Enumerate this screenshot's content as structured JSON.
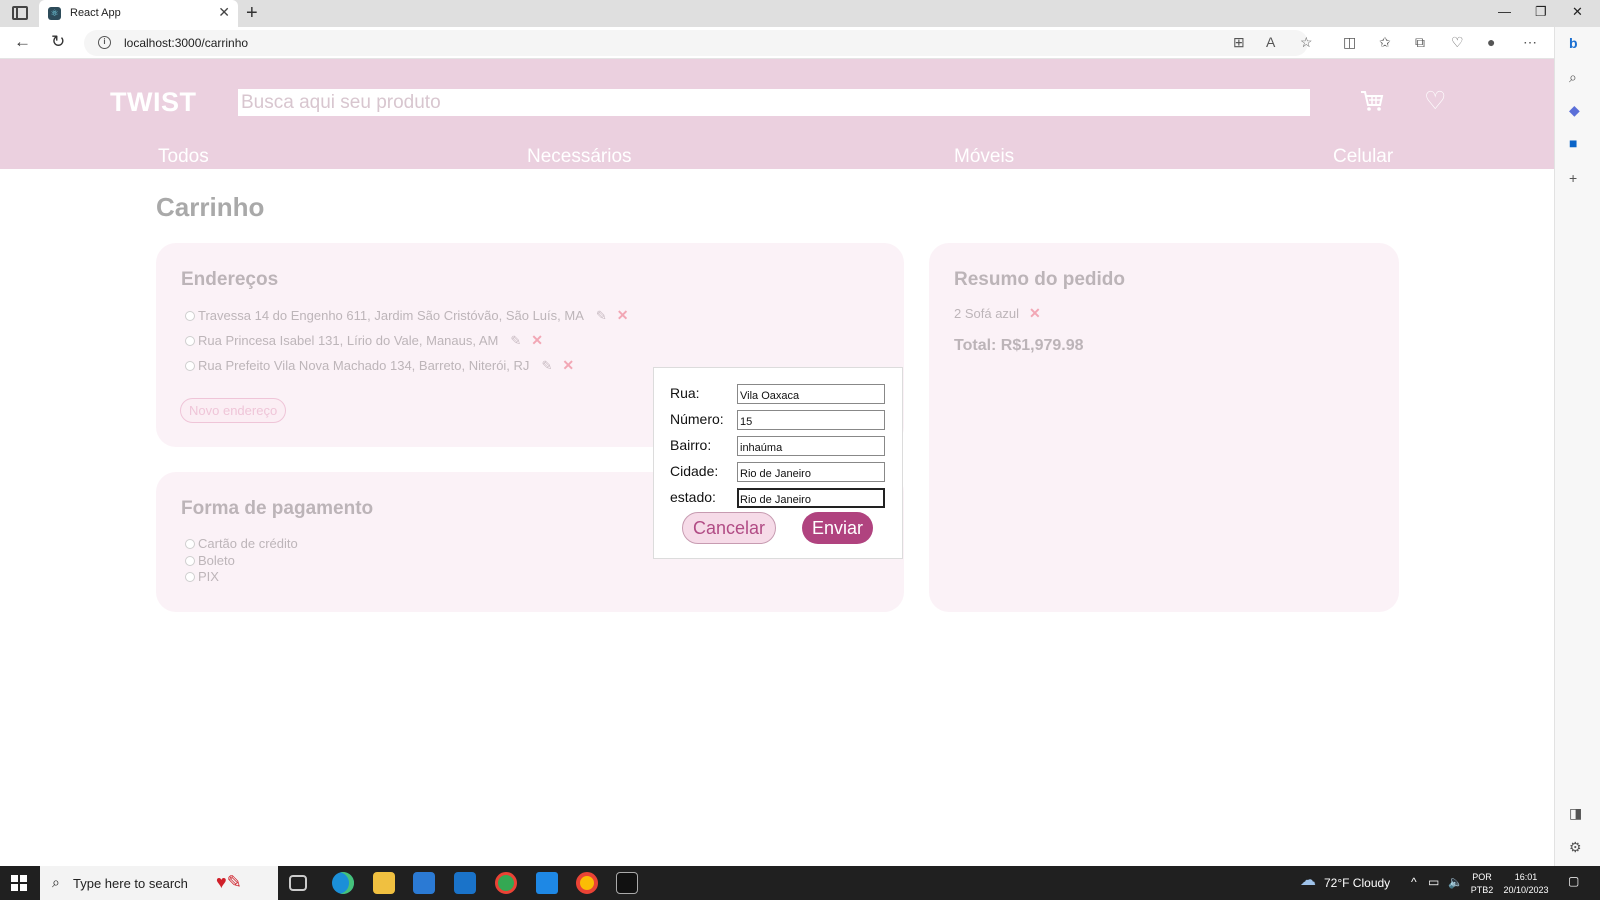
{
  "browser": {
    "tab_title": "React App",
    "url": "localhost:3000/carrinho"
  },
  "header": {
    "logo": "TWIST",
    "search_placeholder": "Busca aqui seu produto",
    "categories": [
      "Todos",
      "Necessários",
      "Móveis",
      "Celular"
    ]
  },
  "page_title": "Carrinho",
  "enderecos": {
    "title": "Endereços",
    "items": [
      "Travessa 14 do Engenho 611, Jardim São Cristóvão, São Luís, MA",
      "Rua Princesa Isabel 131, Lírio do Vale, Manaus, AM",
      "Rua Prefeito Vila Nova Machado 134, Barreto, Niterói, RJ"
    ],
    "new_button": "Novo endereço"
  },
  "pagamento": {
    "title": "Forma de pagamento",
    "options": [
      "Cartão de crédito",
      "Boleto",
      "PIX"
    ]
  },
  "resumo": {
    "title": "Resumo do pedido",
    "item": "2 Sofá azul",
    "total": "Total: R$1,979.98"
  },
  "modal": {
    "fields": [
      {
        "label": "Rua:",
        "value": "Vila Oaxaca"
      },
      {
        "label": "Número:",
        "value": "15"
      },
      {
        "label": "Bairro:",
        "value": "inhaúma"
      },
      {
        "label": "Cidade:",
        "value": "Rio de Janeiro"
      },
      {
        "label": "estado:",
        "value": "Rio de Janeiro"
      }
    ],
    "cancel": "Cancelar",
    "submit": "Enviar"
  },
  "taskbar": {
    "search_text": "Type here to search",
    "weather": "72°F  Cloudy",
    "lang_1": "POR",
    "lang_2": "PTB2",
    "time": "16:01",
    "date": "20/10/2023"
  },
  "colors": {
    "header_bg": "#ebd0df",
    "accent": "#b0437f",
    "card_bg": "#fbf2f7"
  }
}
